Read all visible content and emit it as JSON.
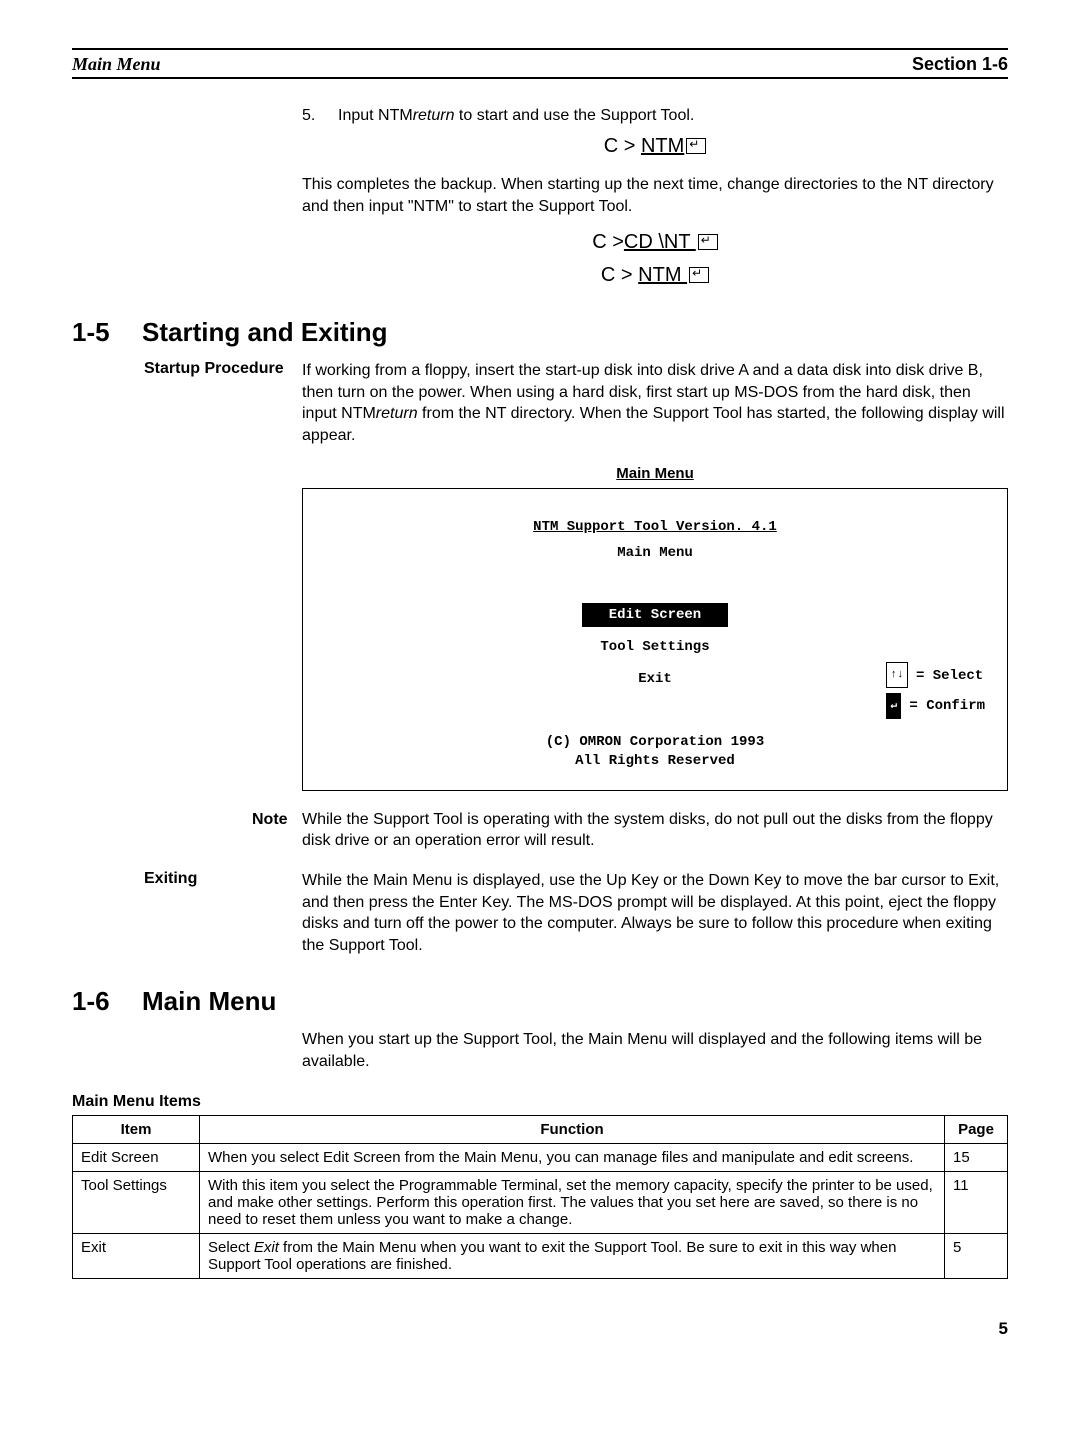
{
  "running_head": {
    "left": "Main Menu",
    "right": "Section 1-6"
  },
  "step5": {
    "number": "5.",
    "text_before": "Input NTM",
    "text_italic": "return",
    "text_after": " to start and use the Support Tool."
  },
  "cmd1": {
    "prompt": "C > ",
    "cmd": "NTM"
  },
  "para_backup": "This completes the backup. When starting up the next time, change directories to the NT directory and then input \"NTM\" to start the Support Tool.",
  "cmd2": {
    "prompt": "C >",
    "cmd": "CD \\NT "
  },
  "cmd3": {
    "prompt": "C > ",
    "cmd": "NTM "
  },
  "section_1_5": {
    "num": "1-5",
    "title": "Starting and Exiting"
  },
  "startup": {
    "label": "Startup Procedure",
    "text": "If working from a floppy, insert the start-up disk into disk drive A and a data disk into disk drive B, then turn on the power. When using a hard disk, first start up MS-DOS from the hard disk, then input NTM",
    "italic": "return",
    "text2": " from the NT directory. When the Support Tool has started, the following display will appear."
  },
  "screen": {
    "caption": "Main Menu",
    "title_line": "NTM Support Tool Version. 4.1",
    "subtitle": "Main Menu",
    "menu": [
      "Edit Screen",
      "Tool Settings",
      "Exit"
    ],
    "legend_select": " = Select",
    "legend_confirm": " = Confirm",
    "arrows": "↑↓",
    "copyright1": "(C) OMRON Corporation 1993",
    "copyright2": "All Rights Reserved"
  },
  "note": {
    "label": "Note",
    "text": "While the Support Tool is operating with the system disks, do not pull out the disks from the floppy disk drive or an operation error will result."
  },
  "exiting": {
    "label": "Exiting",
    "text": "While the Main Menu is displayed, use the Up Key or the Down Key to move the bar cursor to Exit, and then press the Enter Key. The MS-DOS prompt will be displayed. At this point, eject the floppy disks and turn off the power to the computer. Always be sure to follow this procedure when exiting the Support Tool."
  },
  "section_1_6": {
    "num": "1-6",
    "title": "Main Menu"
  },
  "para_1_6": "When you start up the Support Tool, the Main Menu will displayed and the following items will be available.",
  "table": {
    "title": "Main Menu Items",
    "headers": {
      "item": "Item",
      "function": "Function",
      "page": "Page"
    },
    "rows": [
      {
        "item": "Edit Screen",
        "function": "When you select Edit Screen from the Main Menu, you can manage files and manipulate and edit screens.",
        "page": "15"
      },
      {
        "item": "Tool Settings",
        "function": "With this item you select the Programmable Terminal, set the memory capacity, specify the printer to be used, and make other settings. Perform this operation first. The values that you set here are saved, so there is no need to reset them unless you want to make a change.",
        "page": "11"
      },
      {
        "item": "Exit",
        "function_pre": "Select ",
        "function_italic": "Exit",
        "function_post": " from the Main Menu when you want to exit the Support Tool. Be sure to exit in this way when Support Tool operations are finished.",
        "page": "5"
      }
    ]
  },
  "page_number": "5"
}
